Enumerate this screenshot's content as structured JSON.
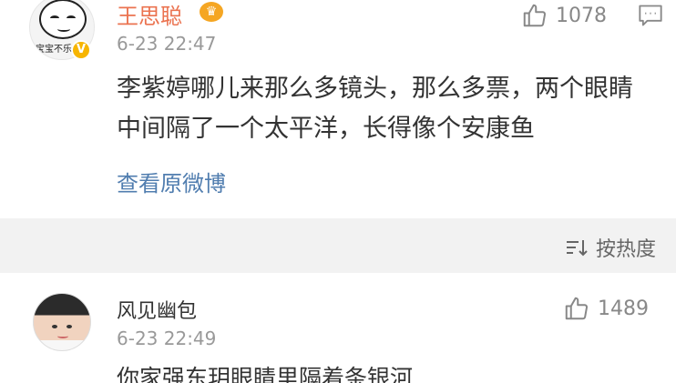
{
  "post": {
    "username": "王思聪",
    "timestamp": "6-23 22:47",
    "likes": "1078",
    "content": "李紫婷哪儿来那么多镜头，那么多票，两个眼睛中间隔了一个太平洋，长得像个安康鱼",
    "view_original": "查看原微博",
    "avatar_caption": "宝宝不乐"
  },
  "sort": {
    "label": "按热度"
  },
  "comment": {
    "username": "风见幽包",
    "timestamp": "6-23 22:49",
    "likes": "1489",
    "content": "你家强东玥眼睛里隔着条银河"
  },
  "colors": {
    "username_highlight": "#eb7350",
    "link": "#507daf",
    "separator_bg": "#f2f2f2",
    "verified_badge": "#f7b500"
  },
  "icons": {
    "like": "thumb-up-icon",
    "reply": "comment-bubble-icon",
    "sort": "sort-lines-icon",
    "crown": "crown-icon",
    "verified": "verified-v-icon"
  }
}
